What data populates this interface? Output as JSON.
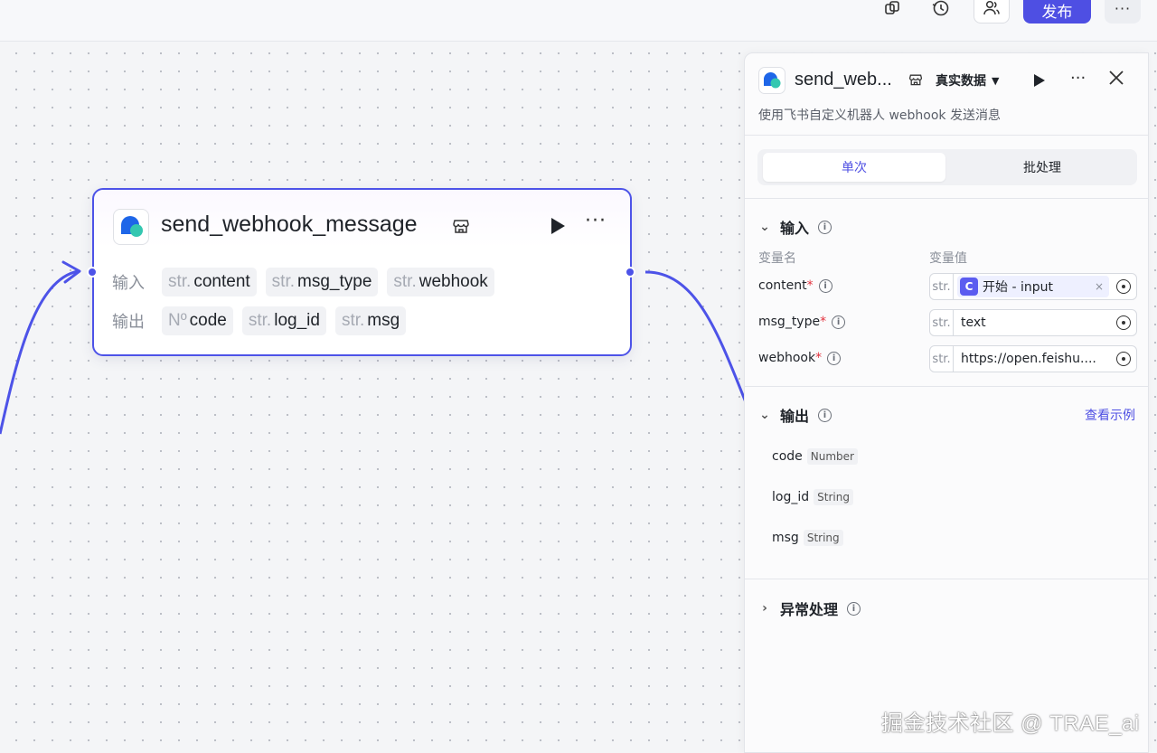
{
  "topbar": {
    "icons": [
      "copy-icon",
      "history-icon",
      "users-icon"
    ],
    "publish_label": "发布",
    "more_label": "···"
  },
  "node": {
    "title": "send_webhook_message",
    "more_label": "···",
    "input_label": "输入",
    "output_label": "输出",
    "inputs": [
      {
        "type": "str.",
        "name": "content"
      },
      {
        "type": "str.",
        "name": "msg_type"
      },
      {
        "type": "str.",
        "name": "webhook"
      }
    ],
    "outputs": [
      {
        "type": "Nº",
        "name": "code"
      },
      {
        "type": "str.",
        "name": "log_id"
      },
      {
        "type": "str.",
        "name": "msg"
      }
    ]
  },
  "panel": {
    "title": "send_web...",
    "data_mode": "真实数据",
    "description": "使用飞书自定义机器人 webhook 发送消息",
    "tabs": [
      {
        "label": "单次",
        "active": true
      },
      {
        "label": "批处理",
        "active": false
      }
    ],
    "input_section": {
      "title": "输入",
      "col_name": "变量名",
      "col_value": "变量值",
      "rows": [
        {
          "name": "content",
          "type": "str.",
          "ref_icon": "C",
          "value": "开始 - input",
          "clear": "×"
        },
        {
          "name": "msg_type",
          "type": "str.",
          "value": "text"
        },
        {
          "name": "webhook",
          "type": "str.",
          "value": "https://open.feishu...."
        }
      ]
    },
    "output_section": {
      "title": "输出",
      "see_example": "查看示例",
      "items": [
        {
          "name": "code",
          "type": "Number"
        },
        {
          "name": "log_id",
          "type": "String"
        },
        {
          "name": "msg",
          "type": "String"
        }
      ]
    },
    "error_section": {
      "title": "异常处理"
    }
  },
  "watermark": "掘金技术社区 @ TRAE_ai",
  "colors": {
    "accent": "#4e4fe3",
    "required": "#e3323e",
    "edge": "#4d53e8"
  }
}
